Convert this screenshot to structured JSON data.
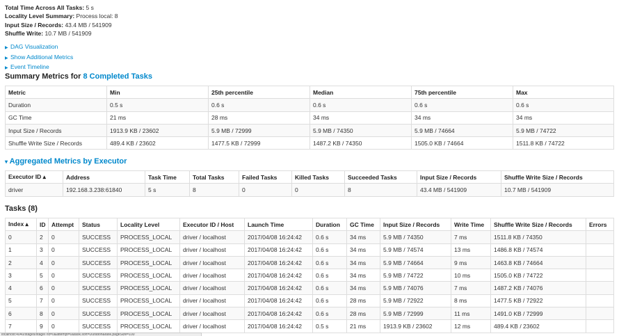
{
  "summary": {
    "total_time_label": "Total Time Across All Tasks:",
    "total_time_value": "5 s",
    "locality_label": "Locality Level Summary:",
    "locality_value": "Process local: 8",
    "input_label": "Input Size / Records:",
    "input_value": "43.4 MB / 541909",
    "shuffle_label": "Shuffle Write:",
    "shuffle_value": "10.7 MB / 541909"
  },
  "links": [
    "DAG Visualization",
    "Show Additional Metrics",
    "Event Timeline"
  ],
  "metrics_section": {
    "title_prefix": "Summary Metrics for",
    "title_link": "8 Completed Tasks",
    "headers": [
      "Metric",
      "Min",
      "25th percentile",
      "Median",
      "75th percentile",
      "Max"
    ],
    "rows": [
      [
        "Duration",
        "0.5 s",
        "0.6 s",
        "0.6 s",
        "0.6 s",
        "0.6 s"
      ],
      [
        "GC Time",
        "21 ms",
        "28 ms",
        "34 ms",
        "34 ms",
        "34 ms"
      ],
      [
        "Input Size / Records",
        "1913.9 KB / 23602",
        "5.9 MB / 72999",
        "5.9 MB / 74350",
        "5.9 MB / 74664",
        "5.9 MB / 74722"
      ],
      [
        "Shuffle Write Size / Records",
        "489.4 KB / 23602",
        "1477.5 KB / 72999",
        "1487.2 KB / 74350",
        "1505.0 KB / 74664",
        "1511.8 KB / 74722"
      ]
    ]
  },
  "executor_section": {
    "title": "Aggregated Metrics by Executor",
    "headers": [
      "Executor ID ▴",
      "Address",
      "Task Time",
      "Total Tasks",
      "Failed Tasks",
      "Killed Tasks",
      "Succeeded Tasks",
      "Input Size / Records",
      "Shuffle Write Size / Records"
    ],
    "rows": [
      [
        "driver",
        "192.168.3.238:61840",
        "5 s",
        "8",
        "0",
        "0",
        "8",
        "43.4 MB / 541909",
        "10.7 MB / 541909"
      ]
    ]
  },
  "tasks_section": {
    "title": "Tasks (8)",
    "headers": [
      "Index ▴",
      "ID",
      "Attempt",
      "Status",
      "Locality Level",
      "Executor ID / Host",
      "Launch Time",
      "Duration",
      "GC Time",
      "Input Size / Records",
      "Write Time",
      "Shuffle Write Size / Records",
      "Errors"
    ],
    "rows": [
      [
        "0",
        "2",
        "0",
        "SUCCESS",
        "PROCESS_LOCAL",
        "driver / localhost",
        "2017/04/08 16:24:42",
        "0.6 s",
        "34 ms",
        "5.9 MB / 74350",
        "7 ms",
        "1511.8 KB / 74350",
        ""
      ],
      [
        "1",
        "3",
        "0",
        "SUCCESS",
        "PROCESS_LOCAL",
        "driver / localhost",
        "2017/04/08 16:24:42",
        "0.6 s",
        "34 ms",
        "5.9 MB / 74574",
        "13 ms",
        "1486.8 KB / 74574",
        ""
      ],
      [
        "2",
        "4",
        "0",
        "SUCCESS",
        "PROCESS_LOCAL",
        "driver / localhost",
        "2017/04/08 16:24:42",
        "0.6 s",
        "34 ms",
        "5.9 MB / 74664",
        "9 ms",
        "1463.8 KB / 74664",
        ""
      ],
      [
        "3",
        "5",
        "0",
        "SUCCESS",
        "PROCESS_LOCAL",
        "driver / localhost",
        "2017/04/08 16:24:42",
        "0.6 s",
        "34 ms",
        "5.9 MB / 74722",
        "10 ms",
        "1505.0 KB / 74722",
        ""
      ],
      [
        "4",
        "6",
        "0",
        "SUCCESS",
        "PROCESS_LOCAL",
        "driver / localhost",
        "2017/04/08 16:24:42",
        "0.6 s",
        "34 ms",
        "5.9 MB / 74076",
        "7 ms",
        "1487.2 KB / 74076",
        ""
      ],
      [
        "5",
        "7",
        "0",
        "SUCCESS",
        "PROCESS_LOCAL",
        "driver / localhost",
        "2017/04/08 16:24:42",
        "0.6 s",
        "28 ms",
        "5.9 MB / 72922",
        "8 ms",
        "1477.5 KB / 72922",
        ""
      ],
      [
        "6",
        "8",
        "0",
        "SUCCESS",
        "PROCESS_LOCAL",
        "driver / localhost",
        "2017/04/08 16:24:42",
        "0.6 s",
        "28 ms",
        "5.9 MB / 72999",
        "11 ms",
        "1491.0 KB / 72999",
        ""
      ],
      [
        "7",
        "9",
        "0",
        "SUCCESS",
        "PROCESS_LOCAL",
        "driver / localhost",
        "2017/04/08 16:24:42",
        "0.5 s",
        "21 ms",
        "1913.9 KB / 23602",
        "12 ms",
        "489.4 KB / 23602",
        ""
      ]
    ]
  },
  "status_bar": "localhost:4040/stages/stage/?id=0&attempt=0&task.sort=Duration&task.pageSize=100"
}
